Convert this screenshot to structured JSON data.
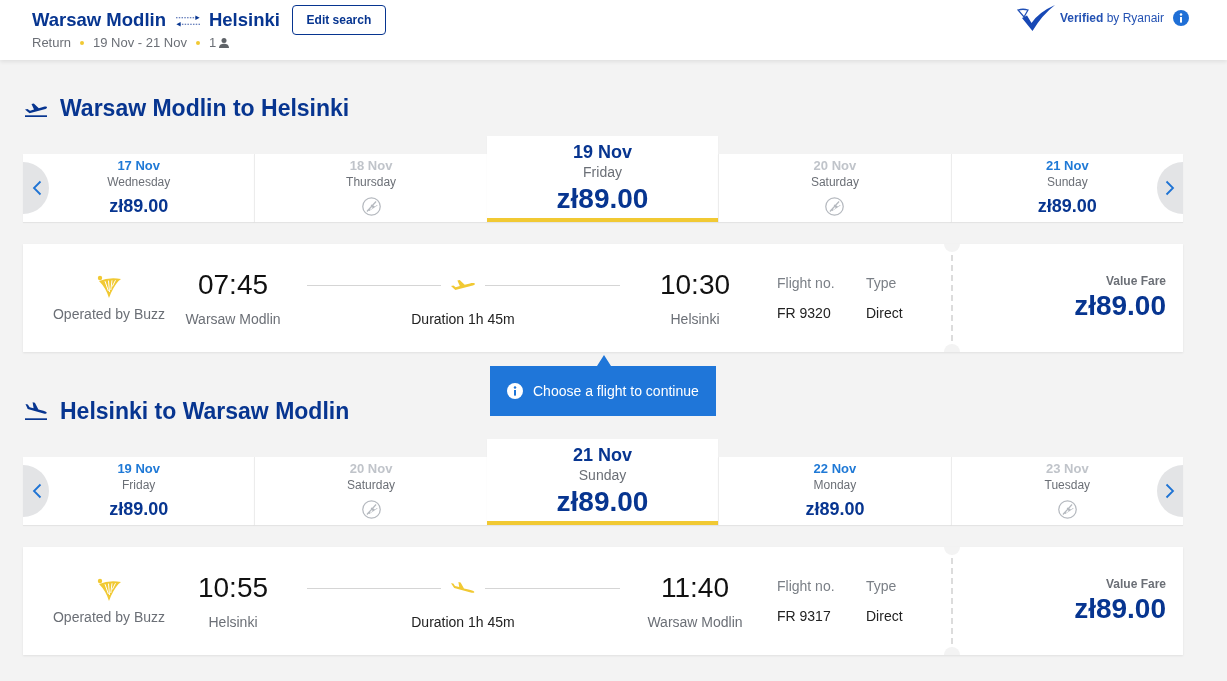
{
  "header": {
    "origin": "Warsaw Modlin",
    "destination": "Helsinki",
    "edit_button": "Edit search",
    "trip_type": "Return",
    "dates": "19 Nov - 21 Nov",
    "passengers": "1",
    "verified": "**Verified** by Ryanair"
  },
  "journeys": [
    {
      "kind": "outbound",
      "title": "Warsaw Modlin to Helsinki",
      "dates": [
        {
          "date": "17 Nov",
          "day": "Wednesday",
          "price": "zł89.00",
          "available": true,
          "selected": false
        },
        {
          "date": "18 Nov",
          "day": "Thursday",
          "available": false,
          "selected": false
        },
        {
          "date": "19 Nov",
          "day": "Friday",
          "price": "zł89.00",
          "available": true,
          "selected": true
        },
        {
          "date": "20 Nov",
          "day": "Saturday",
          "available": false,
          "selected": false
        },
        {
          "date": "21 Nov",
          "day": "Sunday",
          "price": "zł89.00",
          "available": true,
          "selected": false
        }
      ],
      "flight": {
        "operator": "Operated by Buzz",
        "departure_time": "07:45",
        "departure_city": "Warsaw Modlin",
        "duration": "Duration 1h 45m",
        "arrival_time": "10:30",
        "arrival_city": "Helsinki",
        "flight_no_label": "Flight no.",
        "flight_no": "FR 9320",
        "type_label": "Type",
        "type": "Direct",
        "fare_label": "Value Fare",
        "price": "zł89.00"
      },
      "tooltip": "Choose a flight to continue"
    },
    {
      "kind": "inbound",
      "title": "Helsinki to Warsaw Modlin",
      "dates": [
        {
          "date": "19 Nov",
          "day": "Friday",
          "price": "zł89.00",
          "available": true,
          "selected": false
        },
        {
          "date": "20 Nov",
          "day": "Saturday",
          "available": false,
          "selected": false
        },
        {
          "date": "21 Nov",
          "day": "Sunday",
          "price": "zł89.00",
          "available": true,
          "selected": true
        },
        {
          "date": "22 Nov",
          "day": "Monday",
          "price": "zł89.00",
          "available": true,
          "selected": false
        },
        {
          "date": "23 Nov",
          "day": "Tuesday",
          "available": false,
          "selected": false
        }
      ],
      "flight": {
        "operator": "Operated by Buzz",
        "departure_time": "10:55",
        "departure_city": "Helsinki",
        "duration": "Duration 1h 45m",
        "arrival_time": "11:40",
        "arrival_city": "Warsaw Modlin",
        "flight_no_label": "Flight no.",
        "flight_no": "FR 9317",
        "type_label": "Type",
        "type": "Direct",
        "fare_label": "Value Fare",
        "price": "zł89.00"
      }
    }
  ]
}
